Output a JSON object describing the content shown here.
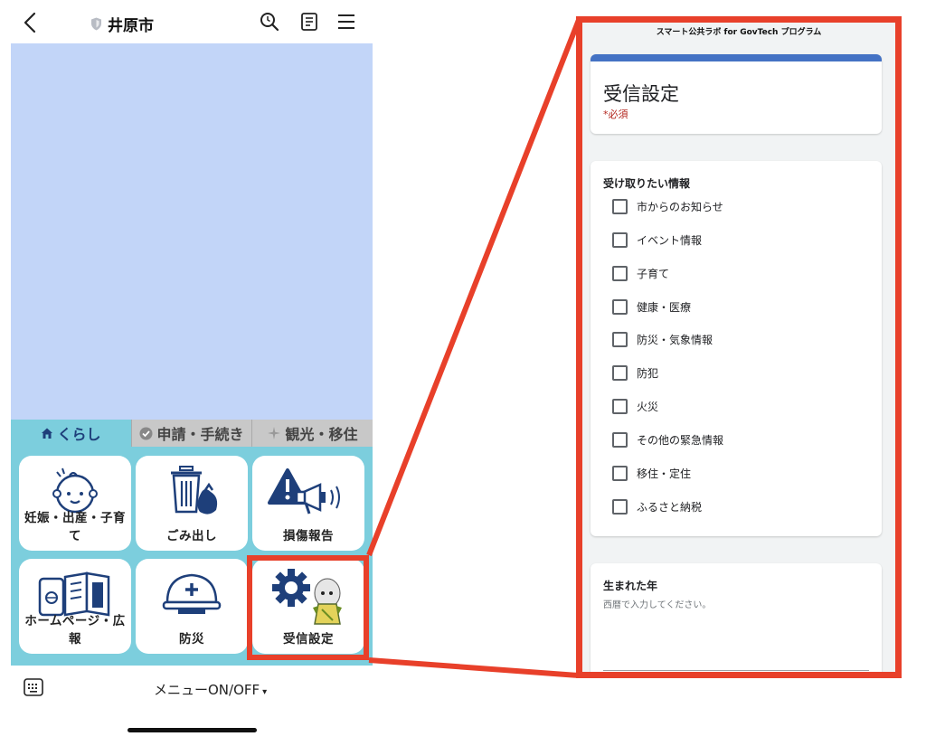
{
  "header": {
    "title": "井原市"
  },
  "rich_menu": {
    "tabs": [
      {
        "label": "くらし",
        "icon": "house-icon",
        "active": true
      },
      {
        "label": "申請・手続き",
        "icon": "check-circle-icon",
        "active": false
      },
      {
        "label": "観光・移住",
        "icon": "sparkle-icon",
        "active": false
      }
    ],
    "tiles": [
      {
        "label": "妊娠・出産・子育て",
        "icon": "baby-icon"
      },
      {
        "label": "ごみ出し",
        "icon": "trash-bin-icon"
      },
      {
        "label": "損傷報告",
        "icon": "warning-megaphone-icon"
      },
      {
        "label": "ホームページ・広報",
        "icon": "phone-newsletter-icon"
      },
      {
        "label": "防災",
        "icon": "helmet-icon"
      },
      {
        "label": "受信設定",
        "icon": "gear-mascot-icon"
      }
    ]
  },
  "bottom_bar": {
    "menu_toggle": "メニューON/OFF",
    "caret": "▾"
  },
  "form": {
    "program_header": "スマート公共ラボ for GovTech プログラム",
    "title": "受信設定",
    "required_note": "*必須",
    "question_title": "受け取りたい情報",
    "options": [
      "市からのお知らせ",
      "イベント情報",
      "子育て",
      "健康・医療",
      "防災・気象情報",
      "防犯",
      "火災",
      "その他の緊急情報",
      "移住・定住",
      "ふるさと納税"
    ],
    "year_title": "生まれた年",
    "year_help": "西暦で入力してください。"
  },
  "colors": {
    "chat_background": "#c2d5f8",
    "menu_background": "#7ccedd",
    "highlight": "#e8402a",
    "form_accent": "#4472c4",
    "icon_navy": "#1e3f7a"
  }
}
